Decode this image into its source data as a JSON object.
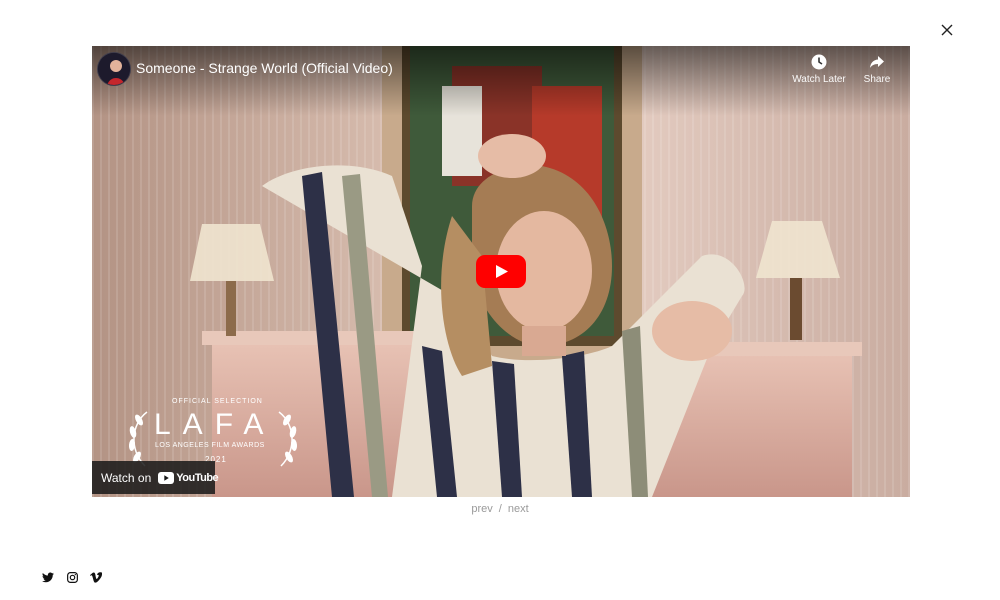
{
  "lightbox": {
    "close_icon": "close-icon"
  },
  "video": {
    "title": "Someone - Strange World (Official Video)",
    "actions": [
      {
        "icon": "clock-icon",
        "label": "Watch Later"
      },
      {
        "icon": "share-icon",
        "label": "Share"
      }
    ],
    "overlay_badge": {
      "selection": "OFFICIAL SELECTION",
      "letters": "LAFA",
      "org": "LOS ANGELES FILM AWARDS",
      "year": "2021"
    },
    "watch_on": {
      "label": "Watch on",
      "brand": "YouTube"
    },
    "colors": {
      "play_button": "#ff0000",
      "overlay_bar": "#171717"
    }
  },
  "pager": {
    "prev": "prev",
    "separator": "/",
    "next": "next"
  },
  "social": [
    "twitter-icon",
    "instagram-icon",
    "vimeo-icon"
  ]
}
